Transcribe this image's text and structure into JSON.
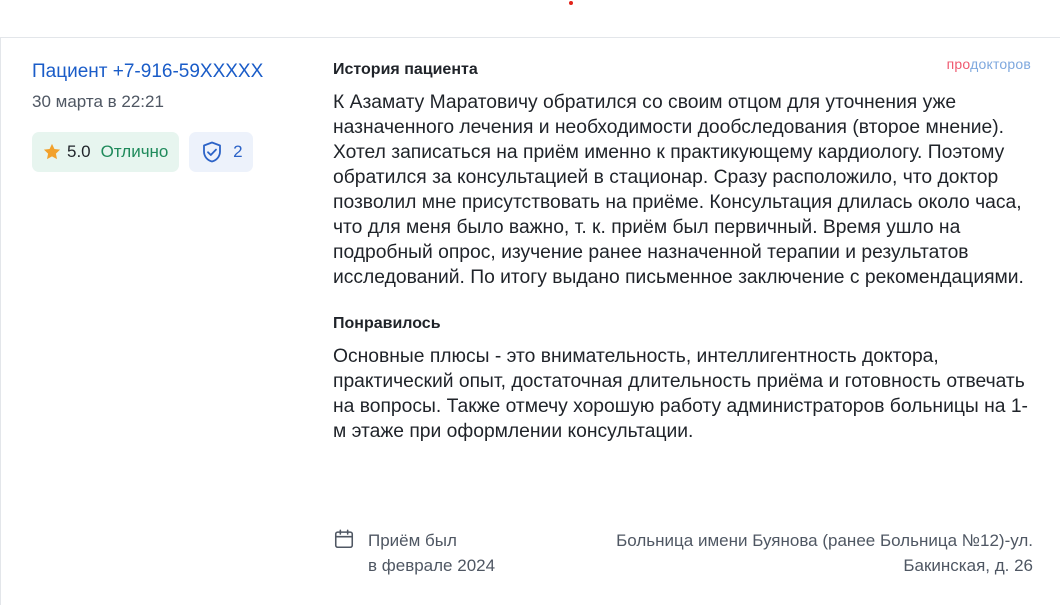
{
  "review": {
    "author": "Пациент +7-916-59XXXXX",
    "date": "30 марта в 22:21",
    "rating": {
      "value": "5.0",
      "label": "Отлично",
      "star_icon": "star-icon",
      "star_color": "#f2a12c"
    },
    "checks": {
      "icon": "shield-check-icon",
      "count": "2"
    },
    "logo": {
      "part1": "про",
      "part2": "докторов"
    },
    "history": {
      "title": "История пациента",
      "text": "К Азамату Маратовичу обратился со своим отцом для уточнения уже назначенного лечения и необходимости дообследования (второе мнение). Хотел записаться на приём именно к практикующему кардиологу. Поэтому обратился за консультацией в стационар. Сразу расположило, что доктор позволил мне присутствовать на приёме. Консультация длилась около часа, что для меня было важно, т. к. приём был первичный. Время ушло на подробный опрос, изучение ранее назначенной терапии и результатов исследований. По итогу выдано письменное заключение с рекомендациями."
    },
    "liked": {
      "title": "Понравилось",
      "text": "Основные плюсы - это внимательность, интеллигентность доктора, практический опыт, достаточная длительность приёма и готовность отвечать на вопросы. Также отмечу хорошую работу администраторов больницы на 1-м этаже при оформлении консультации."
    },
    "visit": {
      "icon": "calendar-icon",
      "line1": "Приём был",
      "line2": "в феврале 2024"
    },
    "clinic": {
      "line1": "Больница имени Буянова (ранее Больница №12)-ул.",
      "line2": "Бакинская, д. 26"
    }
  }
}
